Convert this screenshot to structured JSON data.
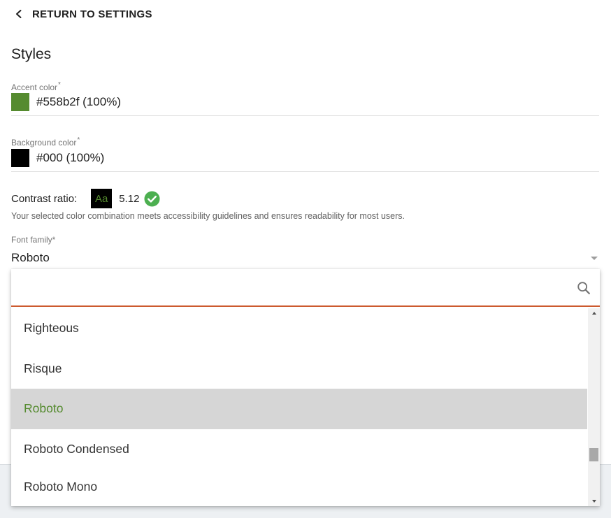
{
  "header": {
    "back_label": "RETURN TO SETTINGS",
    "title": "Styles"
  },
  "accent": {
    "label": "Accent color",
    "required_mark": "*",
    "value": "#558b2f (100%)",
    "swatch_color": "#558b2f"
  },
  "background": {
    "label": "Background color",
    "required_mark": "*",
    "value": "#000 (100%)",
    "swatch_color": "#000000"
  },
  "contrast": {
    "label": "Contrast ratio:",
    "sample_text": "Aa",
    "ratio": "5.12",
    "status_icon": "check-circle-icon",
    "status_color": "#4caf50",
    "note": "Your selected color combination meets accessibility guidelines and ensures readability for most users."
  },
  "font": {
    "label": "Font family*",
    "value": "Roboto"
  },
  "dropdown": {
    "search_value": "",
    "search_icon": "search-icon",
    "underline_color": "#cc5a2e",
    "options": [
      "Righteous",
      "Risque",
      "Roboto",
      "Roboto Condensed",
      "Roboto Mono"
    ],
    "selected_option": "Roboto",
    "selected_color": "#558b2f"
  }
}
